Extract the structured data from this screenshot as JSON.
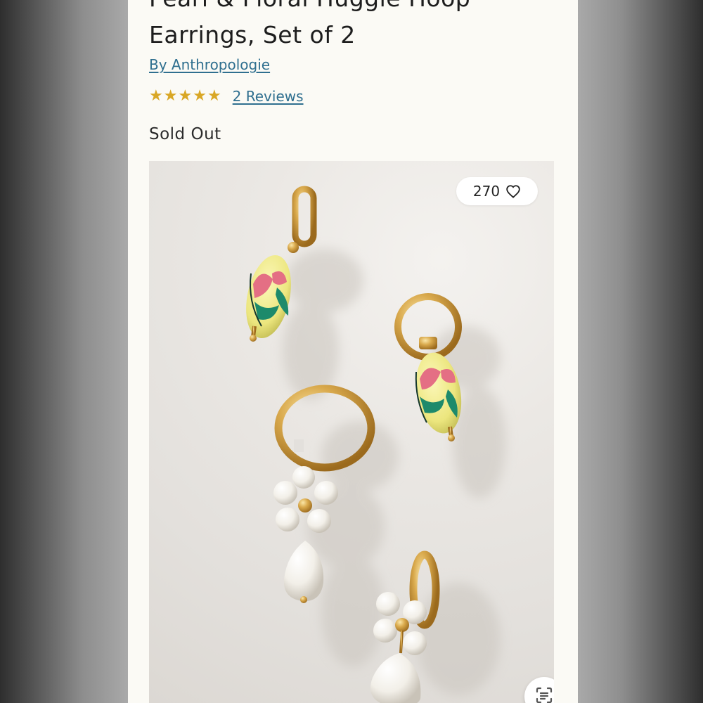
{
  "product": {
    "title_line1": "Pearl & Floral Huggie Hoop",
    "title_line2": "Earrings, Set of 2",
    "brand_link": "By Anthropologie",
    "rating": 5,
    "reviews_link": "2 Reviews",
    "availability": "Sold Out"
  },
  "gallery": {
    "favorites_count": "270",
    "favorite_icon": "heart-outline-icon",
    "scan_icon": "visual-search-icon"
  },
  "colors": {
    "page_background": "#fbfaf5",
    "link": "#2f6f8f",
    "star": "#d9a725"
  }
}
